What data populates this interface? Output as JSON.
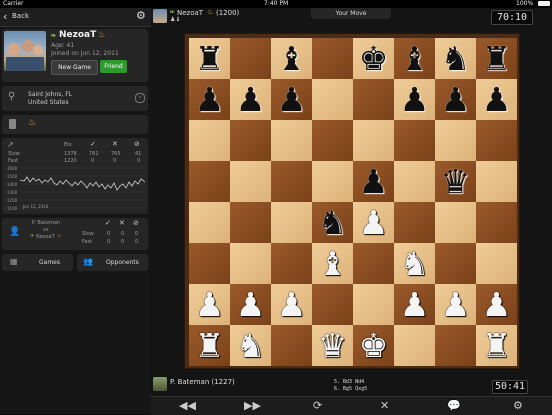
{
  "status_bar": {
    "carrier": "Carrier",
    "time": "7:40 PM",
    "battery": "100%"
  },
  "sidebar": {
    "back_label": "Back",
    "profile": {
      "name": "NezoaT",
      "age": "Age: 41",
      "joined": "Joined on Jun 12, 2011",
      "new_game_label": "New Game",
      "friend_label": "Friend"
    },
    "location": {
      "city": "Saint Johns, FL",
      "country": "United States"
    },
    "stats": {
      "headers": [
        "Elo",
        "✓",
        "✕",
        "⊘"
      ],
      "rows": [
        {
          "label": "Slow",
          "values": [
            "1378",
            "781",
            "765",
            "41"
          ]
        },
        {
          "label": "Fast",
          "values": [
            "1220",
            "0",
            "0",
            "0"
          ]
        }
      ],
      "y_ticks": [
        "1600",
        "1500",
        "1400",
        "1300",
        "1200",
        "1100"
      ],
      "date_label": "Jan 12, 2016"
    },
    "h2h": {
      "player_a": "P. Bateman",
      "vs": "vs",
      "player_b": "NezoaT",
      "rows": [
        {
          "label": "Slow",
          "values": [
            "0",
            "0",
            "0"
          ]
        },
        {
          "label": "Fast",
          "values": [
            "0",
            "0",
            "0"
          ]
        }
      ]
    },
    "games_label": "Games",
    "opponents_label": "Opponents"
  },
  "game": {
    "top_player": "NezoaT",
    "top_rating": "(1200)",
    "turn_label": "Your Move",
    "top_clock": "70:10",
    "bottom_player": "P. Bateman (1227)",
    "bottom_clock": "50:41",
    "moves": [
      "5.  Bd3 Nd4",
      "6.  Bg5 Qxg5"
    ],
    "board": [
      [
        "",
        "",
        "",
        "",
        "",
        "",
        "",
        ""
      ],
      [
        "bR",
        "",
        "bB",
        "",
        "bK",
        "bB",
        "bN",
        "bR"
      ],
      [
        "bP",
        "bP",
        "bP",
        "",
        "",
        "bP",
        "bP",
        "bP"
      ],
      [
        "",
        "",
        "",
        "",
        "",
        "",
        "",
        ""
      ],
      [
        "",
        "",
        "",
        "",
        "bP",
        "",
        "bQ",
        ""
      ],
      [
        "",
        "",
        "",
        "bN",
        "wP",
        "",
        "",
        ""
      ],
      [
        "",
        "",
        "",
        "wB",
        "",
        "wN",
        "",
        ""
      ],
      [
        "wP",
        "wP",
        "wP",
        "",
        "",
        "wP",
        "wP",
        "wP"
      ],
      [
        "wR",
        "wN",
        "",
        "wQ",
        "wK",
        "",
        "",
        "wR"
      ]
    ]
  },
  "icons": [
    "back-icon",
    "gear-icon",
    "location-icon",
    "device-icon",
    "chart-icon",
    "person-icon",
    "games-icon",
    "opponents-icon",
    "rewind-icon",
    "forward-icon",
    "refresh-icon",
    "close-icon",
    "chat-icon",
    "settings-icon"
  ],
  "colors": {
    "friend_green": "#2e9a2e",
    "board_light": "#e9c48d",
    "board_dark": "#8a4e24"
  }
}
